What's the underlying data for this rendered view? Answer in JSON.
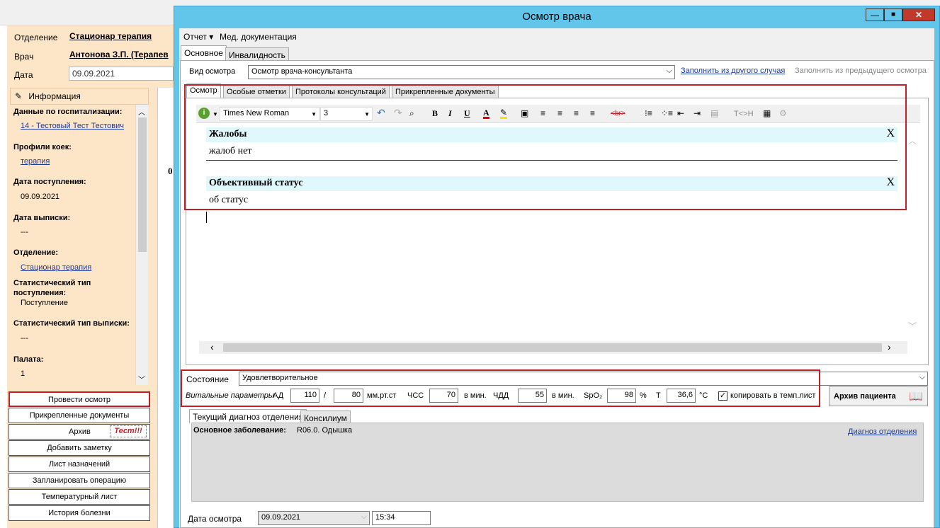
{
  "background": {
    "fields": {
      "dept_label": "Отделение",
      "dept_value": "Стационар терапия",
      "doctor_label": "Врач",
      "doctor_value": "Антонова З.П. (Терапев",
      "date_label": "Дата",
      "date_value": "09.09.2021"
    },
    "info_title": "Информация",
    "info": {
      "hosp_h": "Данные по госпитализации:",
      "hosp_v": "14 - Тестовый Тест Тестович",
      "beds_h": "Профили коек:",
      "beds_v": "терапия",
      "admit_h": "Дата поступления:",
      "admit_v": "09.09.2021",
      "disch_h": "Дата выписки:",
      "disch_v": "---",
      "dept_h": "Отделение:",
      "dept_v": "Стационар терапия",
      "stat_in_h": "Статистический тип поступления:",
      "stat_in_v": "Поступление",
      "stat_out_h": "Статистический тип выписки:",
      "stat_out_v": "---",
      "ward_h": "Палата:",
      "ward_v": "1"
    },
    "buttons": [
      "Провести осмотр",
      "Прикрепленные документы",
      "Архив",
      "Добавить заметку",
      "Лист назначений",
      "Запланировать операцию",
      "Температурный лист",
      "История болезни"
    ],
    "test_badge": "Тест!!!",
    "mid_fragment": "0"
  },
  "dialog": {
    "title": "Осмотр врача",
    "menu": [
      "Отчет ▾",
      "Мед. документация"
    ],
    "main_tabs": [
      "Основное",
      "Инвалидность"
    ],
    "exam_type_label": "Вид осмотра",
    "exam_type_value": "Осмотр врача-консультанта",
    "fill_other": "Заполнить из другого случая",
    "fill_prev": "Заполнить из предыдущего осмотра",
    "inner_tabs": [
      "Осмотр",
      "Особые отметки",
      "Протоколы консультаций",
      "Прикрепленные документы"
    ],
    "font_name": "Times New Roman",
    "font_size": "3",
    "sections": [
      {
        "title": "Жалобы",
        "text": "жалоб нет",
        "x": "X"
      },
      {
        "title": "Объективный статус",
        "text": "об статус",
        "x": "X"
      }
    ],
    "state_label": "Состояние",
    "state_value": "Удовлетворительное",
    "vitals": {
      "label": "Витальные параметры",
      "ad": "АД",
      "ad_sys": "110",
      "slash": "/",
      "ad_dia": "80",
      "ad_unit": "мм.рт.ст",
      "hr": "ЧСС",
      "hr_v": "70",
      "hr_unit": "в мин.",
      "rr": "ЧДД",
      "rr_v": "55",
      "rr_unit": "в мин.",
      "spo": "SpO₂",
      "spo_v": "98",
      "spo_unit": "%",
      "t": "Т",
      "t_v": "36,6",
      "t_unit": "°С",
      "copy": "копировать в темп.лист"
    },
    "archive_btn": "Архив пациента",
    "diag_tabs": [
      "Текущий диагноз отделения",
      "Консилиум"
    ],
    "diag_label": "Основное заболевание:",
    "diag_value": "R06.0. Одышка",
    "diag_link": "Диагноз отделения",
    "exam_date_label": "Дата осмотра",
    "exam_date": "09.09.2021",
    "exam_time": "15:34"
  }
}
